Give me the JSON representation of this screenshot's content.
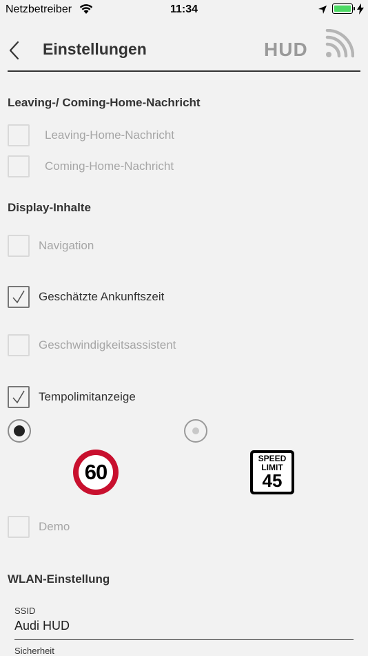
{
  "status_bar": {
    "carrier": "Netzbetreiber",
    "time": "11:34",
    "icons": [
      "wifi-icon",
      "location-arrow-icon",
      "battery-icon",
      "charging-bolt-icon"
    ],
    "battery_color": "#4cd964"
  },
  "header": {
    "title": "Einstellungen",
    "hud_label": "HUD",
    "back_icon": "chevron-left-icon",
    "connection_icon": "rss-signal-icon"
  },
  "sections": {
    "leaving": {
      "title": "Leaving-/ Coming-Home-Nachricht",
      "items": [
        {
          "label": "Leaving-Home-Nachricht",
          "checked": false
        },
        {
          "label": "Coming-Home-Nachricht",
          "checked": false
        }
      ]
    },
    "display": {
      "title": "Display-Inhalte",
      "items": [
        {
          "label": "Navigation",
          "checked": false
        },
        {
          "label": "Geschätzte Ankunftszeit",
          "checked": true
        },
        {
          "label": "Geschwindigkeitsassistent",
          "checked": false
        },
        {
          "label": "Tempolimitanzeige",
          "checked": true
        }
      ],
      "speed_limit_options": [
        {
          "sign": "eu-speed-limit-sign",
          "text": "60",
          "selected": true
        },
        {
          "sign": "us-speed-limit-sign",
          "line1": "SPEED",
          "line2": "LIMIT",
          "value": "45",
          "selected": false
        }
      ],
      "demo": {
        "label": "Demo",
        "checked": false
      }
    },
    "wlan": {
      "title": "WLAN-Einstellung",
      "ssid_label": "SSID",
      "ssid_value": "Audi HUD",
      "security_label": "Sicherheit"
    }
  },
  "colors": {
    "background": "#f2f2f2",
    "sign_red": "#c8102e",
    "muted_text": "#a6a6a6"
  }
}
